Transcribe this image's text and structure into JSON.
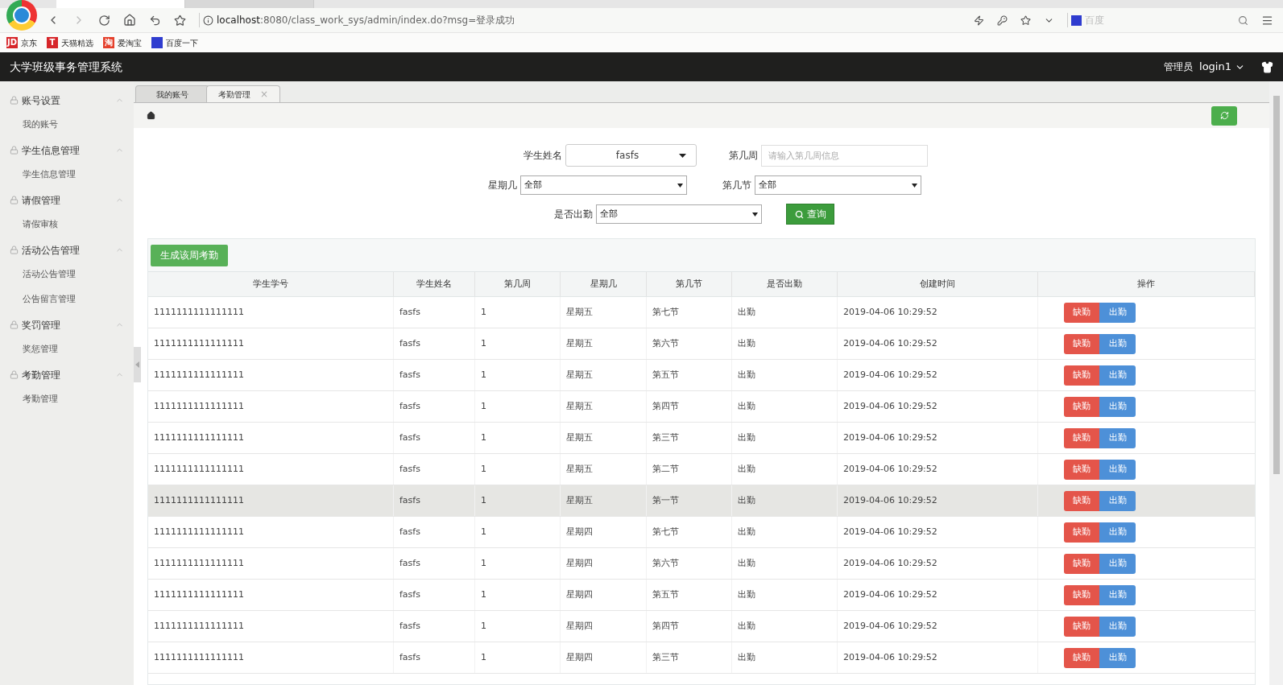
{
  "browser": {
    "tabs": [
      {
        "selected": true
      },
      {
        "selected": false
      }
    ],
    "url_host": "localhost",
    "url_rest": ":8080/class_work_sys/admin/index.do?msg=登录成功",
    "search_placeholder": "百度",
    "bookmarks": [
      {
        "label": "京东",
        "badge": "JD",
        "color": "#d7262a"
      },
      {
        "label": "天猫精选",
        "badge": "T",
        "color": "#d7262a"
      },
      {
        "label": "爱淘宝",
        "badge": "淘",
        "color": "#e5412d"
      },
      {
        "label": "百度一下",
        "color": "#2f3ccf"
      }
    ]
  },
  "header": {
    "title": "大学班级事务管理系统",
    "role": "管理员",
    "user": "login1"
  },
  "sidebar": {
    "groups": [
      {
        "label": "账号设置",
        "expanded": true,
        "children": [
          {
            "label": "我的账号"
          }
        ]
      },
      {
        "label": "学生信息管理",
        "expanded": true,
        "children": [
          {
            "label": "学生信息管理"
          }
        ]
      },
      {
        "label": "请假管理",
        "expanded": true,
        "children": [
          {
            "label": "请假审核"
          }
        ]
      },
      {
        "label": "活动公告管理",
        "expanded": true,
        "children": [
          {
            "label": "活动公告管理"
          },
          {
            "label": "公告留言管理"
          }
        ]
      },
      {
        "label": "奖罚管理",
        "expanded": true,
        "children": [
          {
            "label": "奖惩管理"
          }
        ]
      },
      {
        "label": "考勤管理",
        "expanded": true,
        "children": [
          {
            "label": "考勤管理"
          }
        ]
      }
    ]
  },
  "page_tabs": [
    {
      "label": "我的账号",
      "selected": false
    },
    {
      "label": "考勤管理",
      "selected": true,
      "close_mark": "×"
    }
  ],
  "filters": {
    "student_name": {
      "label": "学生姓名",
      "value": "fasfs"
    },
    "week": {
      "label": "第几周",
      "placeholder": "请输入第几周信息"
    },
    "weekday": {
      "label": "星期几",
      "value": "全部"
    },
    "period": {
      "label": "第几节",
      "value": "全部"
    },
    "attended": {
      "label": "是否出勤",
      "value": "全部"
    },
    "search_button": "查询"
  },
  "generate_button": "生成该周考勤",
  "table": {
    "columns": [
      "学生学号",
      "学生姓名",
      "第几周",
      "星期几",
      "第几节",
      "是否出勤",
      "创建时间",
      "操作"
    ],
    "rows": [
      {
        "id": "1111111111111111",
        "name": "fasfs",
        "week": "1",
        "weekday": "星期五",
        "period": "第七节",
        "attended": "出勤",
        "created": "2019-04-06 10:29:52",
        "absent_button": "缺勤",
        "present_button": "出勤",
        "selected": false
      },
      {
        "id": "1111111111111111",
        "name": "fasfs",
        "week": "1",
        "weekday": "星期五",
        "period": "第六节",
        "attended": "出勤",
        "created": "2019-04-06 10:29:52",
        "absent_button": "缺勤",
        "present_button": "出勤",
        "selected": false
      },
      {
        "id": "1111111111111111",
        "name": "fasfs",
        "week": "1",
        "weekday": "星期五",
        "period": "第五节",
        "attended": "出勤",
        "created": "2019-04-06 10:29:52",
        "absent_button": "缺勤",
        "present_button": "出勤",
        "selected": false
      },
      {
        "id": "1111111111111111",
        "name": "fasfs",
        "week": "1",
        "weekday": "星期五",
        "period": "第四节",
        "attended": "出勤",
        "created": "2019-04-06 10:29:52",
        "absent_button": "缺勤",
        "present_button": "出勤",
        "selected": false
      },
      {
        "id": "1111111111111111",
        "name": "fasfs",
        "week": "1",
        "weekday": "星期五",
        "period": "第三节",
        "attended": "出勤",
        "created": "2019-04-06 10:29:52",
        "absent_button": "缺勤",
        "present_button": "出勤",
        "selected": false
      },
      {
        "id": "1111111111111111",
        "name": "fasfs",
        "week": "1",
        "weekday": "星期五",
        "period": "第二节",
        "attended": "出勤",
        "created": "2019-04-06 10:29:52",
        "absent_button": "缺勤",
        "present_button": "出勤",
        "selected": false
      },
      {
        "id": "1111111111111111",
        "name": "fasfs",
        "week": "1",
        "weekday": "星期五",
        "period": "第一节",
        "attended": "出勤",
        "created": "2019-04-06 10:29:52",
        "absent_button": "缺勤",
        "present_button": "出勤",
        "selected": true
      },
      {
        "id": "1111111111111111",
        "name": "fasfs",
        "week": "1",
        "weekday": "星期四",
        "period": "第七节",
        "attended": "出勤",
        "created": "2019-04-06 10:29:52",
        "absent_button": "缺勤",
        "present_button": "出勤",
        "selected": false
      },
      {
        "id": "1111111111111111",
        "name": "fasfs",
        "week": "1",
        "weekday": "星期四",
        "period": "第六节",
        "attended": "出勤",
        "created": "2019-04-06 10:29:52",
        "absent_button": "缺勤",
        "present_button": "出勤",
        "selected": false
      },
      {
        "id": "1111111111111111",
        "name": "fasfs",
        "week": "1",
        "weekday": "星期四",
        "period": "第五节",
        "attended": "出勤",
        "created": "2019-04-06 10:29:52",
        "absent_button": "缺勤",
        "present_button": "出勤",
        "selected": false
      },
      {
        "id": "1111111111111111",
        "name": "fasfs",
        "week": "1",
        "weekday": "星期四",
        "period": "第四节",
        "attended": "出勤",
        "created": "2019-04-06 10:29:52",
        "absent_button": "缺勤",
        "present_button": "出勤",
        "selected": false
      },
      {
        "id": "1111111111111111",
        "name": "fasfs",
        "week": "1",
        "weekday": "星期四",
        "period": "第三节",
        "attended": "出勤",
        "created": "2019-04-06 10:29:52",
        "absent_button": "缺勤",
        "present_button": "出勤",
        "selected": false
      }
    ]
  }
}
